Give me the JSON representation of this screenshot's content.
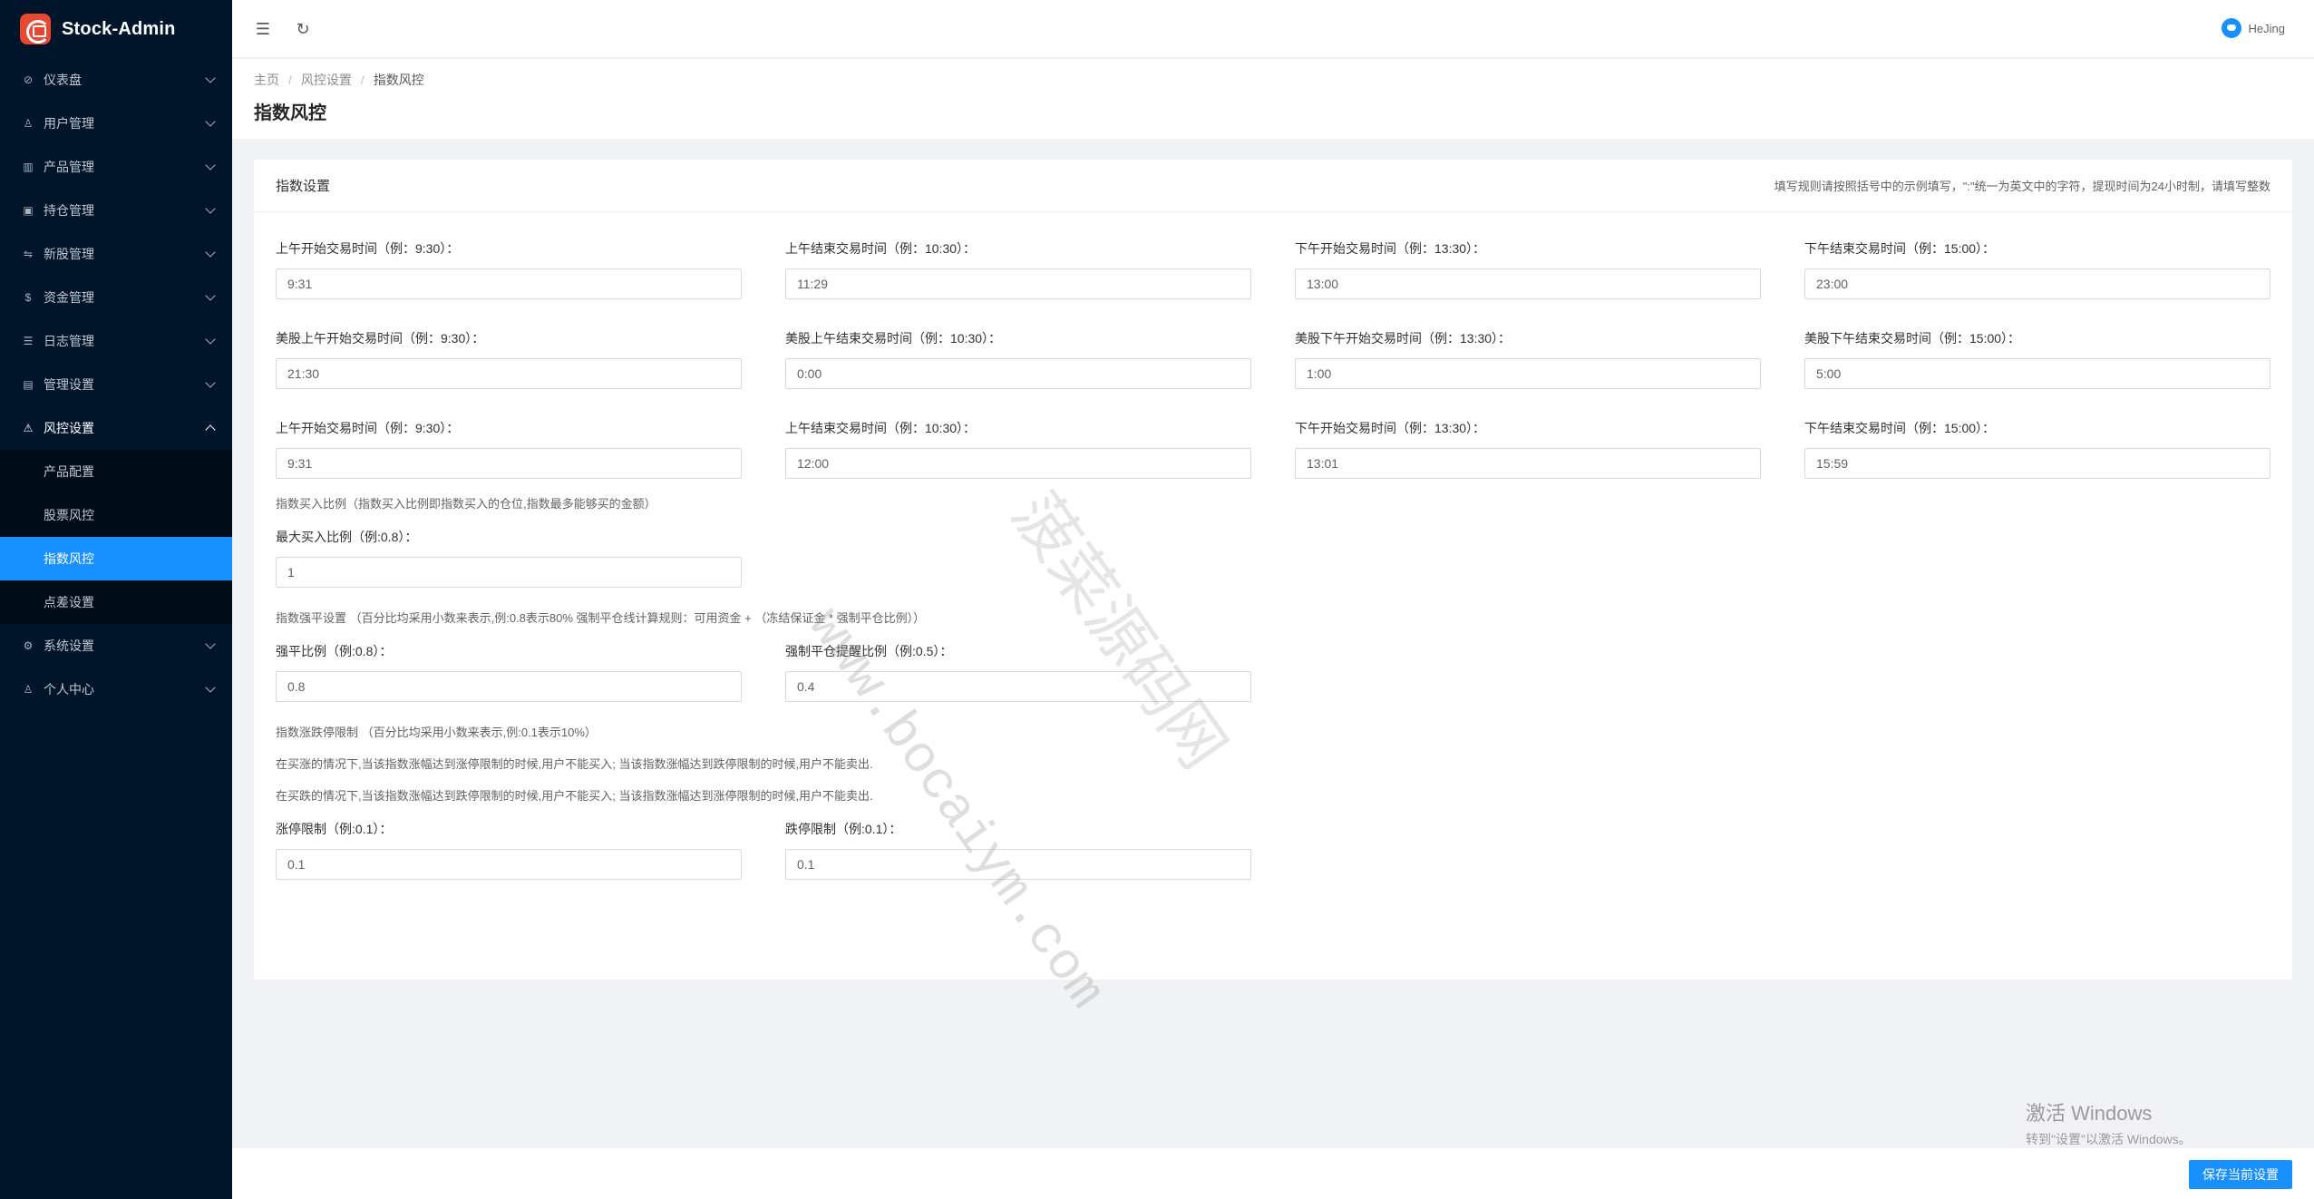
{
  "app": {
    "title": "Stock-Admin"
  },
  "sidebar": {
    "items": [
      {
        "label": "仪表盘",
        "icon": "dashboard-icon",
        "glyph": "⊘"
      },
      {
        "label": "用户管理",
        "icon": "users-icon",
        "glyph": "♙"
      },
      {
        "label": "产品管理",
        "icon": "bar-chart-icon",
        "glyph": "▥"
      },
      {
        "label": "持仓管理",
        "icon": "position-icon",
        "glyph": "▣"
      },
      {
        "label": "新股管理",
        "icon": "ipo-icon",
        "glyph": "⇋"
      },
      {
        "label": "资金管理",
        "icon": "funds-icon",
        "glyph": "$"
      },
      {
        "label": "日志管理",
        "icon": "log-icon",
        "glyph": "☰"
      },
      {
        "label": "管理设置",
        "icon": "admin-settings-icon",
        "glyph": "▤"
      },
      {
        "label": "风控设置",
        "icon": "warning-icon",
        "glyph": "⚠"
      }
    ],
    "risk_sub": [
      {
        "label": "产品配置"
      },
      {
        "label": "股票风控"
      },
      {
        "label": "指数风控"
      },
      {
        "label": "点差设置"
      }
    ],
    "bottom_items": [
      {
        "label": "系统设置",
        "icon": "gear-icon",
        "glyph": "⚙"
      },
      {
        "label": "个人中心",
        "icon": "user-icon",
        "glyph": "♙"
      }
    ]
  },
  "header": {
    "username": "HeJing"
  },
  "breadcrumb": {
    "home": "主页",
    "parent": "风控设置",
    "current": "指数风控"
  },
  "page": {
    "title": "指数风控"
  },
  "card": {
    "title": "指数设置",
    "hint": "填写规则请按照括号中的示例填写，\":\"统一为英文中的字符，提现时间为24小时制，请填写整数"
  },
  "rows": {
    "r1": [
      {
        "label": "上午开始交易时间（例：9:30）：",
        "value": "9:31"
      },
      {
        "label": "上午结束交易时间（例：10:30）：",
        "value": "11:29"
      },
      {
        "label": "下午开始交易时间（例：13:30）：",
        "value": "13:00"
      },
      {
        "label": "下午结束交易时间（例：15:00）：",
        "value": "23:00"
      }
    ],
    "r2": [
      {
        "label": "美股上午开始交易时间（例：9:30）：",
        "value": "21:30"
      },
      {
        "label": "美股上午结束交易时间（例：10:30）：",
        "value": "0:00"
      },
      {
        "label": "美股下午开始交易时间（例：13:30）：",
        "value": "1:00"
      },
      {
        "label": "美股下午结束交易时间（例：15:00）：",
        "value": "5:00"
      }
    ],
    "r3": [
      {
        "label": "上午开始交易时间（例：9:30）：",
        "value": "9:31"
      },
      {
        "label": "上午结束交易时间（例：10:30）：",
        "value": "12:00"
      },
      {
        "label": "下午开始交易时间（例：13:30）：",
        "value": "13:01"
      },
      {
        "label": "下午结束交易时间（例：15:00）：",
        "value": "15:59"
      }
    ]
  },
  "buy_ratio": {
    "note": "指数买入比例（指数买入比例即指数买入的仓位,指数最多能够买的金额）",
    "label": "最大买入比例（例:0.8）：",
    "value": "1"
  },
  "liquidation": {
    "note": "指数强平设置 （百分比均采用小数来表示,例:0.8表示80% 强制平仓线计算规则：可用资金 + （冻结保证金 * 强制平仓比例））",
    "fields": [
      {
        "label": "强平比例（例:0.8）：",
        "value": "0.8"
      },
      {
        "label": "强制平仓提醒比例（例:0.5）：",
        "value": "0.4"
      }
    ]
  },
  "limit": {
    "note": "指数涨跌停限制 （百分比均采用小数来表示,例:0.1表示10%）",
    "line1": "在买涨的情况下,当该指数涨幅达到涨停限制的时候,用户不能买入; 当该指数涨幅达到跌停限制的时候,用户不能卖出.",
    "line2": "在买跌的情况下,当该指数涨幅达到跌停限制的时候,用户不能买入; 当该指数涨幅达到涨停限制的时候,用户不能卖出.",
    "fields": [
      {
        "label": "涨停限制（例:0.1）：",
        "value": "0.1"
      },
      {
        "label": "跌停限制（例:0.1）：",
        "value": "0.1"
      }
    ]
  },
  "footer": {
    "save_label": "保存当前设置"
  },
  "watermark": {
    "site": "www.bocaiym.com",
    "cn": "菠菜源码网"
  },
  "windows": {
    "line1": "激活 Windows",
    "line2": "转到\"设置\"以激活 Windows。"
  },
  "colors": {
    "sidebar_bg": "#001529",
    "accent": "#1890ff",
    "logo": "#e8482f"
  }
}
